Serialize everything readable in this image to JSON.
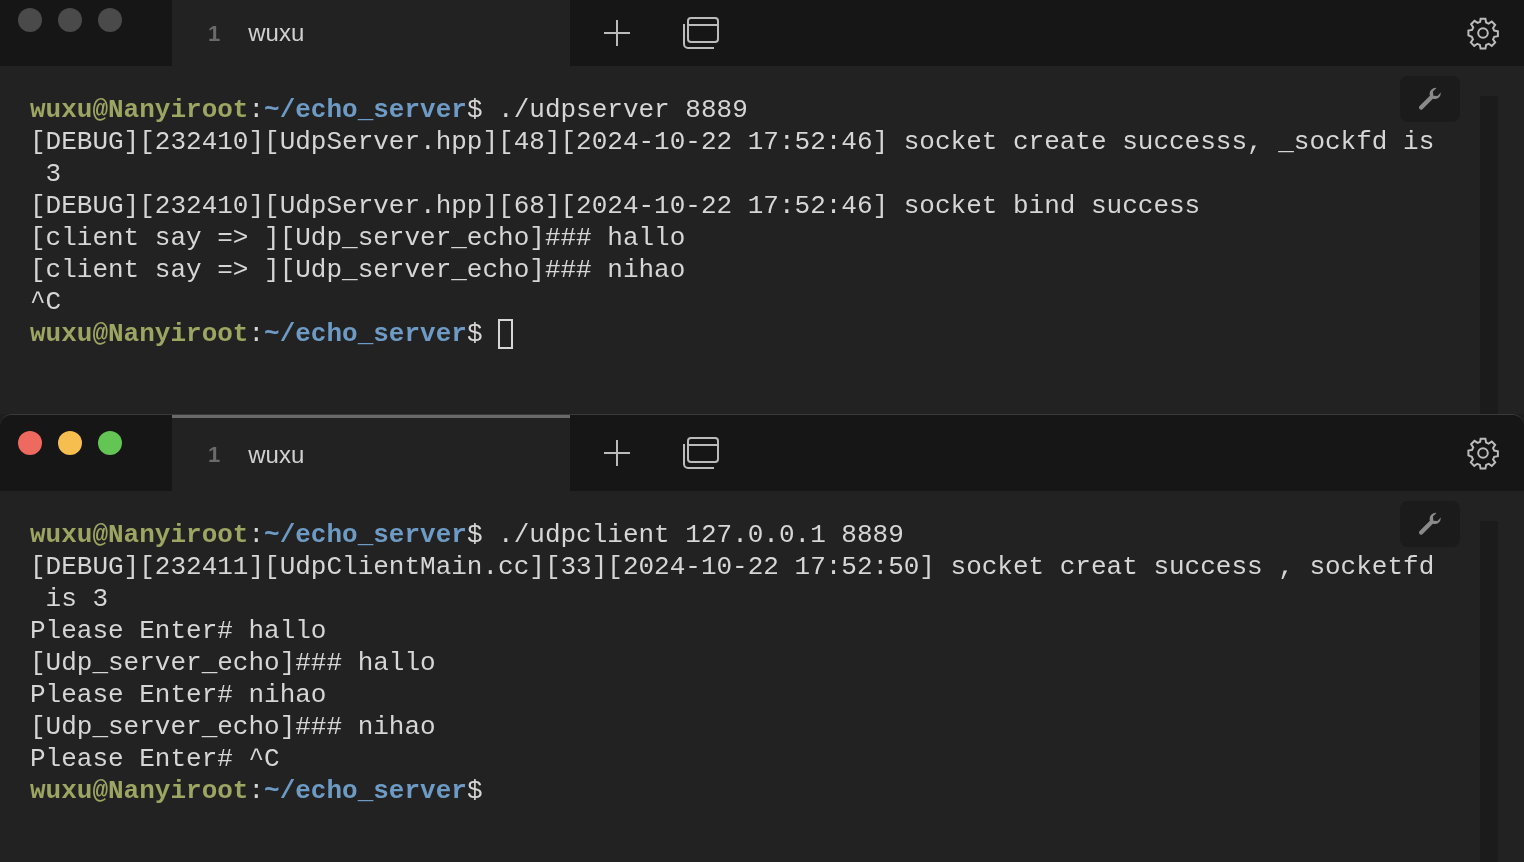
{
  "windows": [
    {
      "active": false,
      "tab": {
        "number": "1",
        "title": "wuxu",
        "selected": true
      },
      "lines": [
        [
          {
            "kind": "user",
            "text": "wuxu@Nanyiroot"
          },
          {
            "kind": "plain",
            "text": ":"
          },
          {
            "kind": "path",
            "text": "~/echo_server"
          },
          {
            "kind": "plain",
            "text": "$ ./udpserver 8889"
          }
        ],
        [
          {
            "kind": "plain",
            "text": "[DEBUG][232410][UdpServer.hpp][48][2024-10-22 17:52:46] socket create successs, _sockfd is"
          }
        ],
        [
          {
            "kind": "plain",
            "text": " 3"
          }
        ],
        [
          {
            "kind": "plain",
            "text": "[DEBUG][232410][UdpServer.hpp][68][2024-10-22 17:52:46] socket bind success"
          }
        ],
        [
          {
            "kind": "plain",
            "text": "[client say => ][Udp_server_echo]### hallo"
          }
        ],
        [
          {
            "kind": "plain",
            "text": "[client say => ][Udp_server_echo]### nihao"
          }
        ],
        [
          {
            "kind": "plain",
            "text": "^C"
          }
        ],
        [
          {
            "kind": "user",
            "text": "wuxu@Nanyiroot"
          },
          {
            "kind": "plain",
            "text": ":"
          },
          {
            "kind": "path",
            "text": "~/echo_server"
          },
          {
            "kind": "plain",
            "text": "$ "
          },
          {
            "kind": "cursor"
          }
        ]
      ]
    },
    {
      "active": true,
      "tab": {
        "number": "1",
        "title": "wuxu",
        "selected": true
      },
      "lines": [
        [
          {
            "kind": "user",
            "text": "wuxu@Nanyiroot"
          },
          {
            "kind": "plain",
            "text": ":"
          },
          {
            "kind": "path",
            "text": "~/echo_server"
          },
          {
            "kind": "plain",
            "text": "$ ./udpclient 127.0.0.1 8889"
          }
        ],
        [
          {
            "kind": "plain",
            "text": "[DEBUG][232411][UdpClientMain.cc][33][2024-10-22 17:52:50] socket creat success , socketfd"
          }
        ],
        [
          {
            "kind": "plain",
            "text": " is 3"
          }
        ],
        [
          {
            "kind": "plain",
            "text": "Please Enter# hallo"
          }
        ],
        [
          {
            "kind": "plain",
            "text": "[Udp_server_echo]### hallo"
          }
        ],
        [
          {
            "kind": "plain",
            "text": "Please Enter# nihao"
          }
        ],
        [
          {
            "kind": "plain",
            "text": "[Udp_server_echo]### nihao"
          }
        ],
        [
          {
            "kind": "plain",
            "text": "Please Enter# ^C"
          }
        ],
        [
          {
            "kind": "user",
            "text": "wuxu@Nanyiroot"
          },
          {
            "kind": "plain",
            "text": ":"
          },
          {
            "kind": "path",
            "text": "~/echo_server"
          },
          {
            "kind": "plain",
            "text": "$"
          }
        ]
      ]
    }
  ]
}
